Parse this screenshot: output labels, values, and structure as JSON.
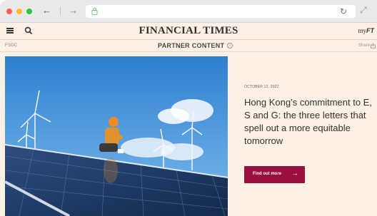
{
  "browser": {
    "back_glyph": "←",
    "forward_glyph": "→",
    "reload_glyph": "↻",
    "extension_glyph": "⤢"
  },
  "header": {
    "logo": "FINANCIAL TIMES",
    "myft_prefix": "my",
    "myft_suffix": "FT"
  },
  "partner_bar": {
    "sponsor": "FSDC",
    "label": "PARTNER CONTENT",
    "info_glyph": "i",
    "share_label": "Share"
  },
  "article": {
    "date": "OCTOBER 13, 2022",
    "headline": "Hong Kong’s commitment to E, S and G: the three letters that spell out a more equitable tomorrow",
    "cta_label": "Find out more",
    "cta_arrow": "→"
  },
  "colors": {
    "background": "#fff1e5",
    "text": "#33302e",
    "cta": "#990f3d",
    "sky": "#3f8fd6",
    "panel": "#1f3a66"
  }
}
